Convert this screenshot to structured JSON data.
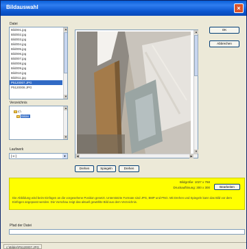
{
  "window": {
    "title": "Bildauswahl",
    "close_glyph": "×"
  },
  "files": {
    "label": "Datei",
    "items": [
      "Bild001.jpg",
      "Bild002.jpg",
      "Bild003.jpg",
      "Bild004.jpg",
      "Bild005.jpg",
      "Bild006.jpg",
      "Bild007.jpg",
      "Bild008.jpg",
      "Bild009.jpg",
      "Bild010.jpg",
      "Bild011.jpg",
      "P5120007.JPG",
      "P5120008.JPG"
    ],
    "selected_index": 11
  },
  "folders": {
    "label": "Verzeichnis",
    "items": [
      "c:\\",
      "Bilder"
    ],
    "selected_index": 1
  },
  "drive": {
    "label": "Laufwerk",
    "value": "[-c-]"
  },
  "buttons": {
    "ok": "OK",
    "cancel": "Abbrechen",
    "rotate_left": "Drehen",
    "mirror": "Spiegeln",
    "rotate_right": "Drehen",
    "details": "Bearbeiten"
  },
  "info": {
    "size_line": "Bildgröße: 1027 x 768",
    "dims_line": "Druckauflösung: 300 x 300",
    "description": "Die Abbildung wird beim Einfügen an die vorgesehene Position gesetzt. Unterstützte Formate sind JPG, BMP und PNG. Mit Drehen und Spiegeln kann das Bild vor dem Einfügen angepasst werden. Die Vorschau zeigt das aktuell gewählte Bild aus dem Verzeichnis."
  },
  "path": {
    "label": "Pfad der Datei",
    "value": ""
  },
  "status": {
    "path": "c:\\Bilder\\P5120007.JPG"
  },
  "colors": {
    "titlebar": "#0a5fd8",
    "info_panel": "#ffff00",
    "selection": "#316ac5"
  }
}
